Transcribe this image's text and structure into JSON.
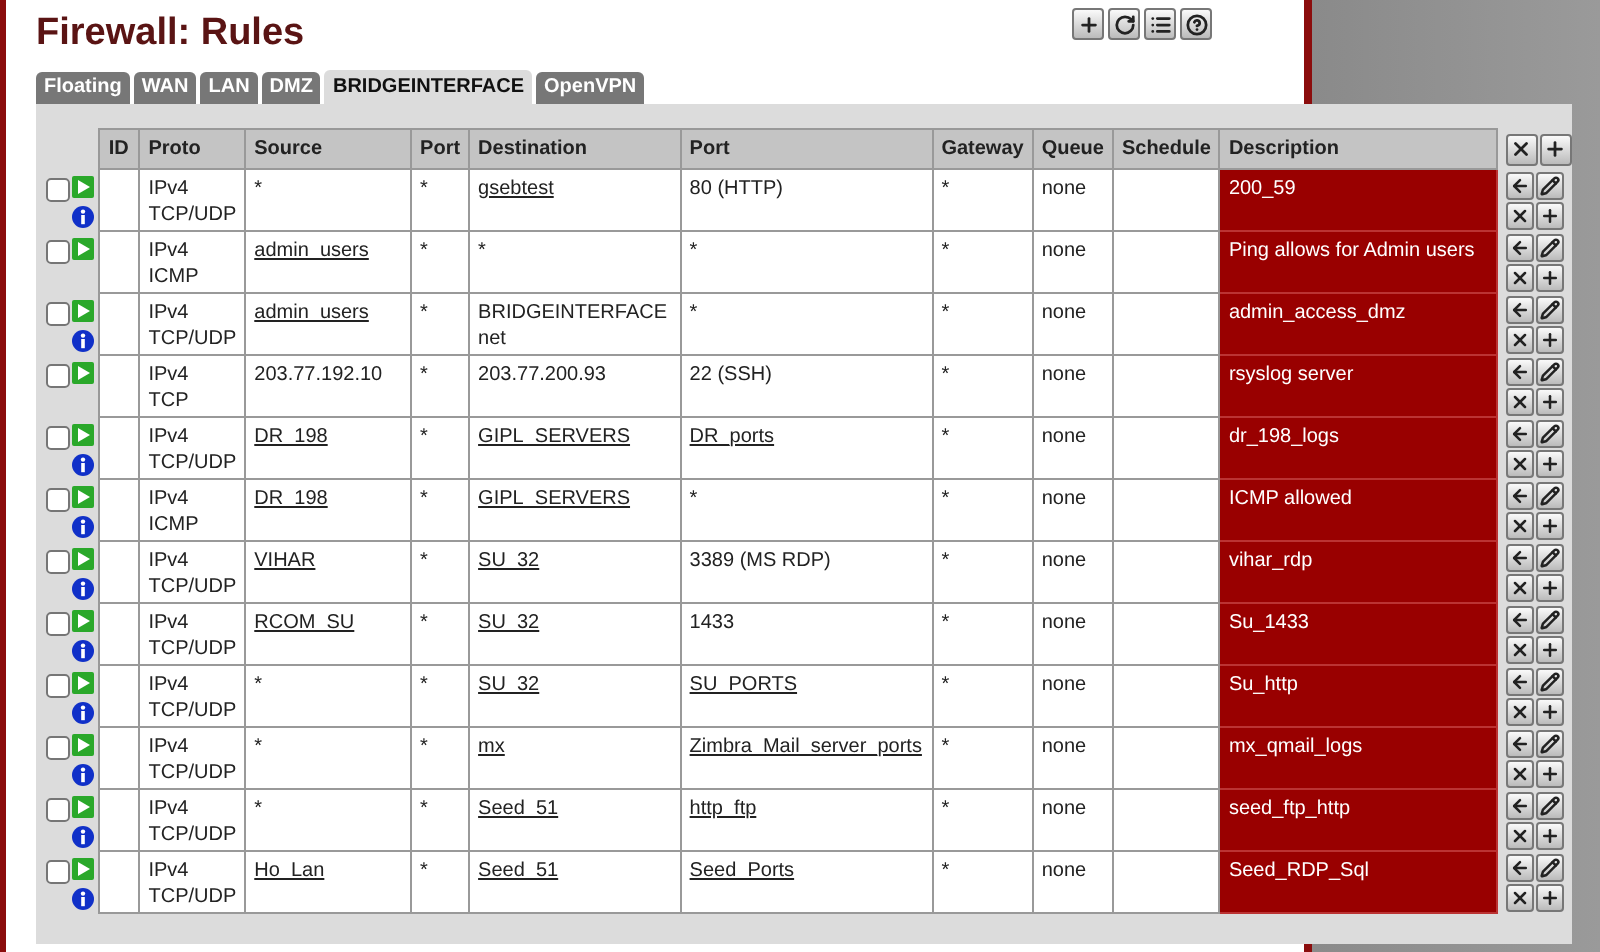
{
  "page": {
    "title": "Firewall: Rules"
  },
  "tabs": [
    {
      "label": "Floating",
      "selected": false
    },
    {
      "label": "WAN",
      "selected": false
    },
    {
      "label": "LAN",
      "selected": false
    },
    {
      "label": "DMZ",
      "selected": false
    },
    {
      "label": "BRIDGEINTERFACE",
      "selected": true
    },
    {
      "label": "OpenVPN",
      "selected": false
    }
  ],
  "table": {
    "columns": [
      "ID",
      "Proto",
      "Source",
      "Port",
      "Destination",
      "Port",
      "Gateway",
      "Queue",
      "Schedule",
      "Description"
    ],
    "rows": [
      {
        "checked": false,
        "info": true,
        "ip": "IPv4",
        "protocol": "TCP/UDP",
        "source": {
          "text": "*",
          "link": false
        },
        "source_port": "*",
        "destination": {
          "text": "gsebtest",
          "link": true
        },
        "destination_port": {
          "text": "80 (HTTP)",
          "link": false
        },
        "gateway": "*",
        "queue": "none",
        "description": "200_59"
      },
      {
        "checked": false,
        "info": false,
        "ip": "IPv4",
        "protocol": "ICMP",
        "source": {
          "text": "admin_users",
          "link": true
        },
        "source_port": "*",
        "destination": {
          "text": "*",
          "link": false
        },
        "destination_port": {
          "text": "*",
          "link": false
        },
        "gateway": "*",
        "queue": "none",
        "description": "Ping allows for Admin users"
      },
      {
        "checked": false,
        "info": true,
        "ip": "IPv4",
        "protocol": "TCP/UDP",
        "source": {
          "text": "admin_users",
          "link": true
        },
        "source_port": "*",
        "destination": {
          "text": "BRIDGEINTERFACE net",
          "link": false
        },
        "destination_port": {
          "text": "*",
          "link": false
        },
        "gateway": "*",
        "queue": "none",
        "description": "admin_access_dmz"
      },
      {
        "checked": false,
        "info": false,
        "ip": "IPv4",
        "protocol": "TCP",
        "source": {
          "text": "203.77.192.10",
          "link": false
        },
        "source_port": "*",
        "destination": {
          "text": "203.77.200.93",
          "link": false
        },
        "destination_port": {
          "text": "22 (SSH)",
          "link": false
        },
        "gateway": "*",
        "queue": "none",
        "description": "rsyslog server"
      },
      {
        "checked": false,
        "info": true,
        "ip": "IPv4",
        "protocol": "TCP/UDP",
        "source": {
          "text": "DR_198",
          "link": true
        },
        "source_port": "*",
        "destination": {
          "text": "GIPL_SERVERS",
          "link": true
        },
        "destination_port": {
          "text": "DR_ports",
          "link": true
        },
        "gateway": "*",
        "queue": "none",
        "description": "dr_198_logs"
      },
      {
        "checked": false,
        "info": true,
        "ip": "IPv4",
        "protocol": "ICMP",
        "source": {
          "text": "DR_198",
          "link": true
        },
        "source_port": "*",
        "destination": {
          "text": "GIPL_SERVERS",
          "link": true
        },
        "destination_port": {
          "text": "*",
          "link": false
        },
        "gateway": "*",
        "queue": "none",
        "description": "ICMP allowed"
      },
      {
        "checked": false,
        "info": true,
        "ip": "IPv4",
        "protocol": "TCP/UDP",
        "source": {
          "text": "VIHAR",
          "link": true
        },
        "source_port": "*",
        "destination": {
          "text": "SU_32",
          "link": true
        },
        "destination_port": {
          "text": "3389 (MS RDP)",
          "link": false
        },
        "gateway": "*",
        "queue": "none",
        "description": "vihar_rdp"
      },
      {
        "checked": false,
        "info": true,
        "ip": "IPv4",
        "protocol": "TCP/UDP",
        "source": {
          "text": "RCOM_SU",
          "link": true
        },
        "source_port": "*",
        "destination": {
          "text": "SU_32",
          "link": true
        },
        "destination_port": {
          "text": "1433",
          "link": false
        },
        "gateway": "*",
        "queue": "none",
        "description": "Su_1433"
      },
      {
        "checked": false,
        "info": true,
        "ip": "IPv4",
        "protocol": "TCP/UDP",
        "source": {
          "text": "*",
          "link": false
        },
        "source_port": "*",
        "destination": {
          "text": "SU_32",
          "link": true
        },
        "destination_port": {
          "text": "SU_PORTS",
          "link": true
        },
        "gateway": "*",
        "queue": "none",
        "description": "Su_http"
      },
      {
        "checked": false,
        "info": true,
        "ip": "IPv4",
        "protocol": "TCP/UDP",
        "source": {
          "text": "*",
          "link": false
        },
        "source_port": "*",
        "destination": {
          "text": "mx",
          "link": true
        },
        "destination_port": {
          "text": "Zimbra_Mail_server_ports",
          "link": true
        },
        "gateway": "*",
        "queue": "none",
        "description": "mx_qmail_logs"
      },
      {
        "checked": false,
        "info": true,
        "ip": "IPv4",
        "protocol": "TCP/UDP",
        "source": {
          "text": "*",
          "link": false
        },
        "source_port": "*",
        "destination": {
          "text": "Seed_51",
          "link": true
        },
        "destination_port": {
          "text": "http_ftp",
          "link": true
        },
        "gateway": "*",
        "queue": "none",
        "description": "seed_ftp_http"
      },
      {
        "checked": false,
        "info": true,
        "ip": "IPv4",
        "protocol": "TCP/UDP",
        "source": {
          "text": "Ho_Lan",
          "link": true
        },
        "source_port": "*",
        "destination": {
          "text": "Seed_51",
          "link": true
        },
        "destination_port": {
          "text": "Seed_Ports",
          "link": true
        },
        "gateway": "*",
        "queue": "none",
        "description": "Seed_RDP_Sql"
      }
    ]
  }
}
